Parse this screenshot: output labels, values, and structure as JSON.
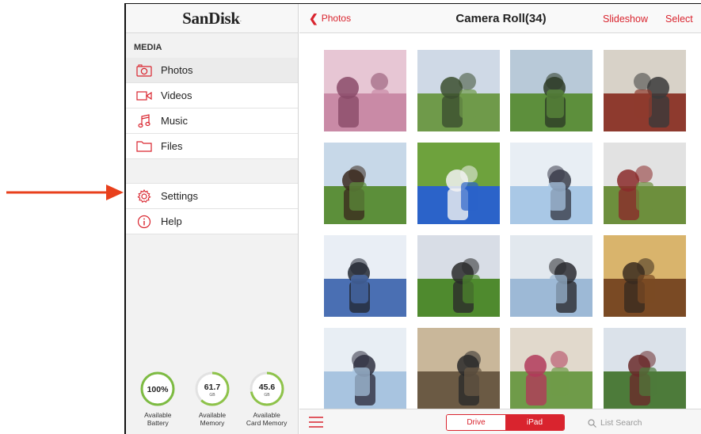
{
  "sidebar": {
    "logo": "SanDisk",
    "logo_mark": "·",
    "section_title": "MEDIA",
    "items": [
      {
        "label": "Photos",
        "icon": "camera-icon",
        "active": true
      },
      {
        "label": "Videos",
        "icon": "video-camera-icon",
        "active": false
      },
      {
        "label": "Music",
        "icon": "music-note-icon",
        "active": false
      },
      {
        "label": "Files",
        "icon": "folder-icon",
        "active": false
      }
    ],
    "items2": [
      {
        "label": "Settings",
        "icon": "gear-icon"
      },
      {
        "label": "Help",
        "icon": "info-icon"
      }
    ],
    "gauges": [
      {
        "value": "100%",
        "unit": "",
        "label": "Available\nBattery",
        "fraction": 1.0,
        "color": "#7dbb42"
      },
      {
        "value": "61.7",
        "unit": "GB",
        "label": "Available\nMemory",
        "fraction": 0.62,
        "color": "#8ec34a"
      },
      {
        "value": "45.6",
        "unit": "GB",
        "label": "Available\nCard Memory",
        "fraction": 0.72,
        "color": "#8ec34a"
      }
    ]
  },
  "header": {
    "back_label": "Photos",
    "title": "Camera Roll(34)",
    "slideshow_label": "Slideshow",
    "select_label": "Select"
  },
  "photos": [
    {
      "name": "photo-cherry-blossom",
      "colors": [
        "#c98aa6",
        "#e7c6d4",
        "#8a4a68"
      ]
    },
    {
      "name": "photo-students-tablet-outdoors",
      "colors": [
        "#6f9a4a",
        "#cfd9e6",
        "#3b4d2e"
      ]
    },
    {
      "name": "photo-picnic-laptop",
      "colors": [
        "#5d8f3c",
        "#b8c9d8",
        "#2d3b26"
      ]
    },
    {
      "name": "photo-woman-laptop-campus",
      "colors": [
        "#8e3a2e",
        "#d8d2c8",
        "#3a3a3a"
      ]
    },
    {
      "name": "photo-group-picnic",
      "colors": [
        "#5c8f3a",
        "#c7d8e8",
        "#3b2a1e"
      ]
    },
    {
      "name": "photo-man-dog-field",
      "colors": [
        "#2b63c9",
        "#6ea23d",
        "#f2f2f2"
      ]
    },
    {
      "name": "photo-winter-couple",
      "colors": [
        "#a9c8e6",
        "#e8eef4",
        "#3a3d4a"
      ]
    },
    {
      "name": "photo-woman-library",
      "colors": [
        "#6d8f3d",
        "#e2e2e2",
        "#8a2a2a"
      ]
    },
    {
      "name": "photo-snow-photographer",
      "colors": [
        "#4a6fb3",
        "#e9eef5",
        "#222833"
      ]
    },
    {
      "name": "photo-camera-park",
      "colors": [
        "#4f8a2e",
        "#d8dde6",
        "#2a2a2a"
      ]
    },
    {
      "name": "photo-group-friends",
      "colors": [
        "#9db9d6",
        "#e2e8ee",
        "#2a2a30"
      ]
    },
    {
      "name": "photo-woman-laptop-home",
      "colors": [
        "#7a4a24",
        "#d9b46c",
        "#3a2b1f"
      ]
    },
    {
      "name": "photo-winter-hikers",
      "colors": [
        "#a8c4e0",
        "#e8eef4",
        "#2f3040"
      ]
    },
    {
      "name": "photo-man-restaurant",
      "colors": [
        "#6b5a44",
        "#c9b79a",
        "#2a2a2a"
      ]
    },
    {
      "name": "photo-woman-bike",
      "colors": [
        "#6f9b49",
        "#e1d9cc",
        "#b13a5a"
      ]
    },
    {
      "name": "photo-couple-table",
      "colors": [
        "#4d7b3a",
        "#dbe2ea",
        "#6a2a2a"
      ]
    }
  ],
  "bottombar": {
    "menu_icon": "hamburger-icon",
    "seg_drive": "Drive",
    "seg_ipad": "iPad",
    "search_placeholder": "List Search"
  },
  "colors": {
    "accent": "#d9242e",
    "arrow": "#e8401c"
  }
}
